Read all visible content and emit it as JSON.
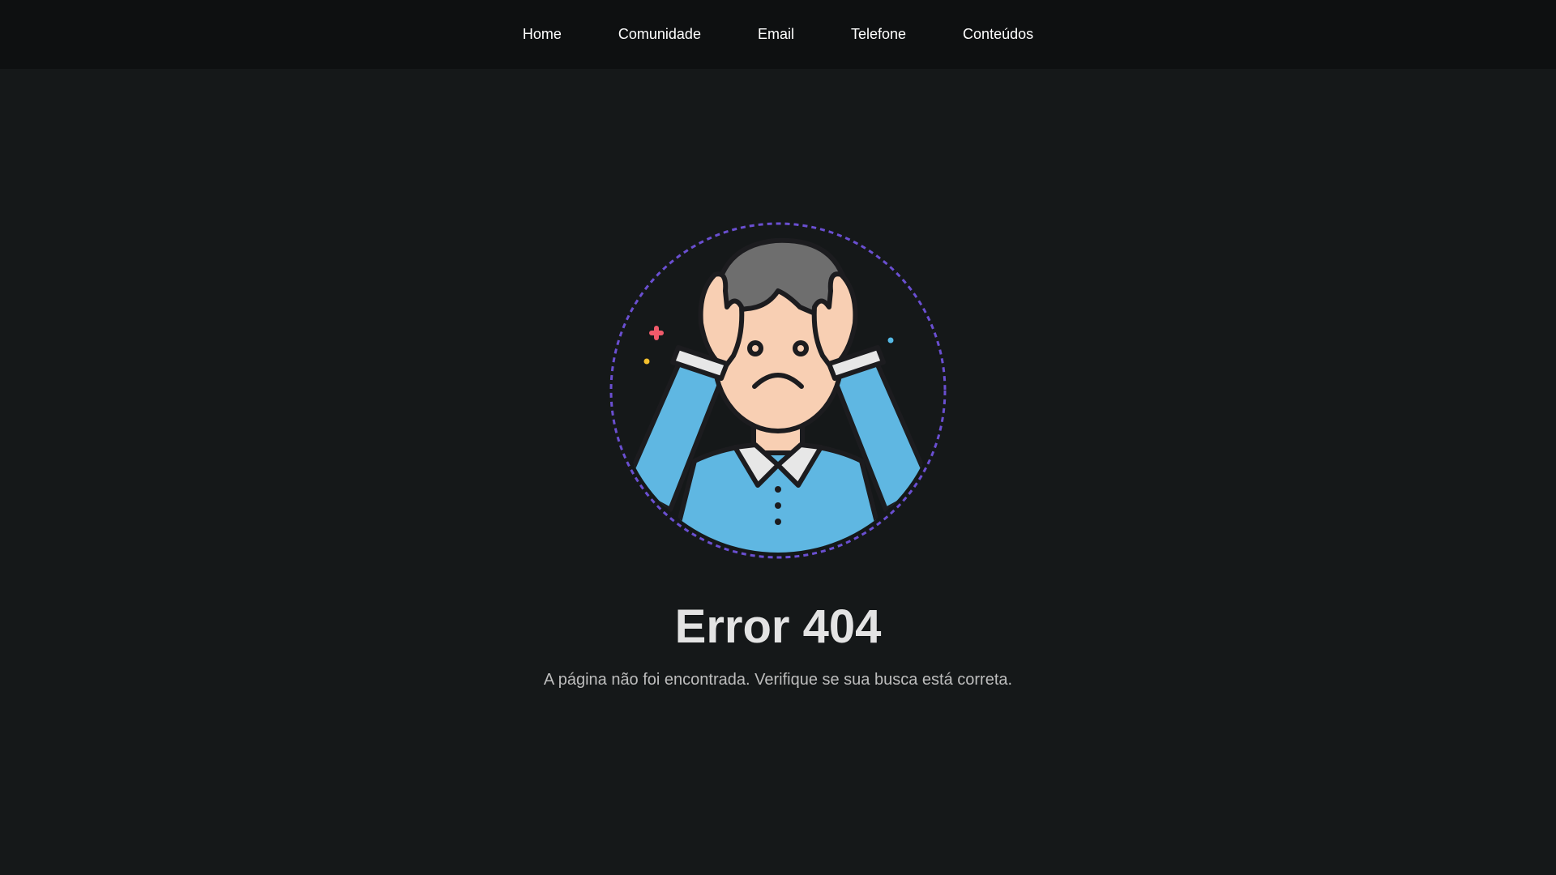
{
  "nav": {
    "items": [
      {
        "label": "Home"
      },
      {
        "label": "Comunidade"
      },
      {
        "label": "Email"
      },
      {
        "label": "Telefone"
      },
      {
        "label": "Conteúdos"
      }
    ]
  },
  "error": {
    "title": "Error 404",
    "message": "A página não foi encontrada. Verifique se sua busca está correta."
  },
  "illustration": {
    "icon": "frustrated-person-icon",
    "colors": {
      "ring": "#6a4fd1",
      "shirt": "#5fb7e2",
      "skin": "#f8cfb3",
      "hair": "#6e6e6e",
      "outline": "#1c1c1f",
      "collar": "#e7e7e7",
      "sparkle_red": "#f05a6a",
      "sparkle_yellow": "#f5c02d",
      "sparkle_blue": "#55b9e6"
    }
  },
  "theme": {
    "background": "#151819",
    "navbar": "#0e1011",
    "text": "#e3e3e3"
  }
}
